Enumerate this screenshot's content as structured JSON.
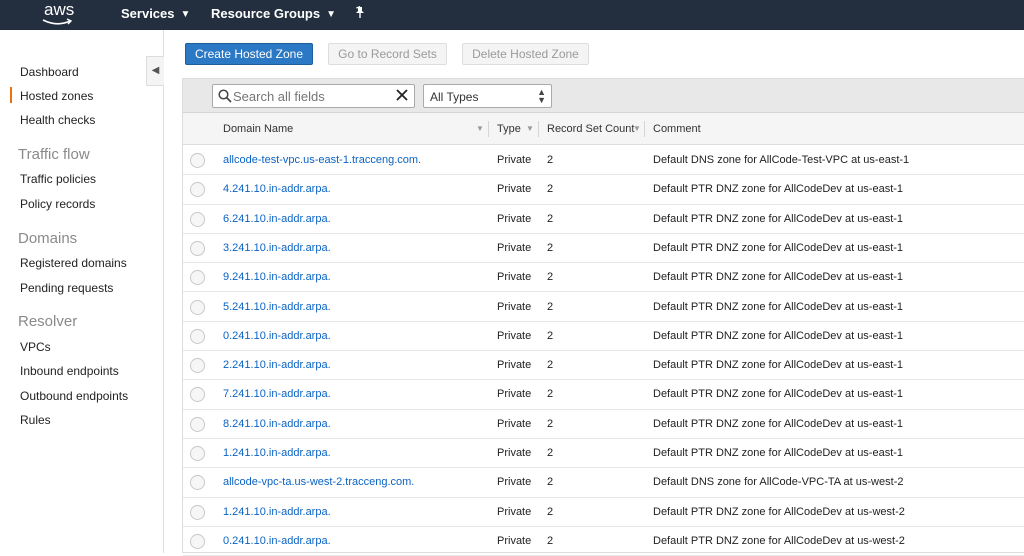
{
  "nav": {
    "logo": "aws",
    "services": "Services",
    "resource_groups": "Resource Groups"
  },
  "sidebar": {
    "items": [
      {
        "type": "link",
        "label": "Dashboard"
      },
      {
        "type": "link",
        "label": "Hosted zones",
        "active": true
      },
      {
        "type": "link",
        "label": "Health checks"
      },
      {
        "type": "heading",
        "label": "Traffic flow"
      },
      {
        "type": "link",
        "label": "Traffic policies"
      },
      {
        "type": "link",
        "label": "Policy records"
      },
      {
        "type": "heading",
        "label": "Domains"
      },
      {
        "type": "link",
        "label": "Registered domains"
      },
      {
        "type": "link",
        "label": "Pending requests"
      },
      {
        "type": "heading",
        "label": "Resolver"
      },
      {
        "type": "link",
        "label": "VPCs"
      },
      {
        "type": "link",
        "label": "Inbound endpoints"
      },
      {
        "type": "link",
        "label": "Outbound endpoints"
      },
      {
        "type": "link",
        "label": "Rules"
      }
    ]
  },
  "toolbar": {
    "create": "Create Hosted Zone",
    "goto": "Go to Record Sets",
    "delete": "Delete Hosted Zone"
  },
  "filter": {
    "search_placeholder": "Search all fields",
    "type_selected": "All Types"
  },
  "table": {
    "columns": [
      "Domain Name",
      "Type",
      "Record Set Count",
      "Comment"
    ],
    "rows": [
      {
        "domain": "allcode-test-vpc.us-east-1.tracceng.com.",
        "type": "Private",
        "count": "2",
        "comment": "Default DNS zone for AllCode-Test-VPC at us-east-1"
      },
      {
        "domain": "4.241.10.in-addr.arpa.",
        "type": "Private",
        "count": "2",
        "comment": "Default PTR DNZ zone for AllCodeDev at us-east-1"
      },
      {
        "domain": "6.241.10.in-addr.arpa.",
        "type": "Private",
        "count": "2",
        "comment": "Default PTR DNZ zone for AllCodeDev at us-east-1"
      },
      {
        "domain": "3.241.10.in-addr.arpa.",
        "type": "Private",
        "count": "2",
        "comment": "Default PTR DNZ zone for AllCodeDev at us-east-1"
      },
      {
        "domain": "9.241.10.in-addr.arpa.",
        "type": "Private",
        "count": "2",
        "comment": "Default PTR DNZ zone for AllCodeDev at us-east-1"
      },
      {
        "domain": "5.241.10.in-addr.arpa.",
        "type": "Private",
        "count": "2",
        "comment": "Default PTR DNZ zone for AllCodeDev at us-east-1"
      },
      {
        "domain": "0.241.10.in-addr.arpa.",
        "type": "Private",
        "count": "2",
        "comment": "Default PTR DNZ zone for AllCodeDev at us-east-1"
      },
      {
        "domain": "2.241.10.in-addr.arpa.",
        "type": "Private",
        "count": "2",
        "comment": "Default PTR DNZ zone for AllCodeDev at us-east-1"
      },
      {
        "domain": "7.241.10.in-addr.arpa.",
        "type": "Private",
        "count": "2",
        "comment": "Default PTR DNZ zone for AllCodeDev at us-east-1"
      },
      {
        "domain": "8.241.10.in-addr.arpa.",
        "type": "Private",
        "count": "2",
        "comment": "Default PTR DNZ zone for AllCodeDev at us-east-1"
      },
      {
        "domain": "1.241.10.in-addr.arpa.",
        "type": "Private",
        "count": "2",
        "comment": "Default PTR DNZ zone for AllCodeDev at us-east-1"
      },
      {
        "domain": "allcode-vpc-ta.us-west-2.tracceng.com.",
        "type": "Private",
        "count": "2",
        "comment": "Default DNS zone for AllCode-VPC-TA at us-west-2"
      },
      {
        "domain": "1.241.10.in-addr.arpa.",
        "type": "Private",
        "count": "2",
        "comment": "Default PTR DNZ zone for AllCodeDev at us-west-2"
      },
      {
        "domain": "0.241.10.in-addr.arpa.",
        "type": "Private",
        "count": "2",
        "comment": "Default PTR DNZ zone for AllCodeDev at us-west-2"
      }
    ]
  },
  "colors": {
    "nav_bg": "#232f3e",
    "primary": "#2b78c5",
    "link": "#0b63c4",
    "active_marker": "#ec7211"
  }
}
